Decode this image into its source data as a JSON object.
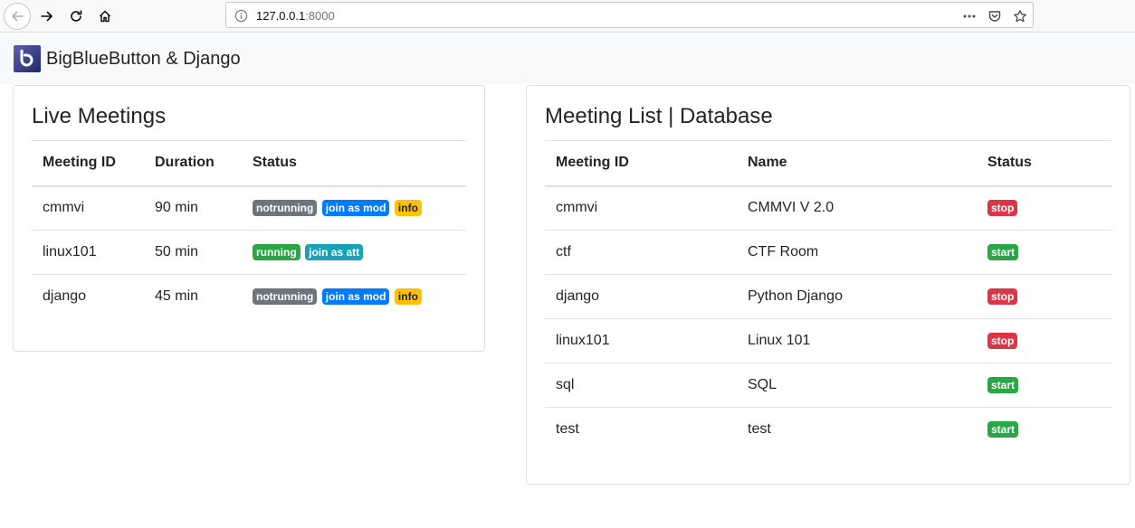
{
  "browser": {
    "url_host": "127.0.0.1",
    "url_port": ":8000"
  },
  "app": {
    "brand": "BigBlueButton & Django"
  },
  "live_meetings": {
    "title": "Live Meetings",
    "headers": {
      "meeting_id": "Meeting ID",
      "duration": "Duration",
      "status": "Status"
    },
    "rows": [
      {
        "meeting_id": "cmmvi",
        "duration": "90 min",
        "badges": [
          {
            "label": "notrunning",
            "color": "secondary"
          },
          {
            "label": "join as mod",
            "color": "primary"
          },
          {
            "label": "info",
            "color": "warning"
          }
        ]
      },
      {
        "meeting_id": "linux101",
        "duration": "50 min",
        "badges": [
          {
            "label": "running",
            "color": "success"
          },
          {
            "label": "join as att",
            "color": "info"
          }
        ]
      },
      {
        "meeting_id": "django",
        "duration": "45 min",
        "badges": [
          {
            "label": "notrunning",
            "color": "secondary"
          },
          {
            "label": "join as mod",
            "color": "primary"
          },
          {
            "label": "info",
            "color": "warning"
          }
        ]
      }
    ]
  },
  "meeting_db": {
    "title": "Meeting List | Database",
    "headers": {
      "meeting_id": "Meeting ID",
      "name": "Name",
      "status": "Status"
    },
    "rows": [
      {
        "meeting_id": "cmmvi",
        "name": "CMMVI V 2.0",
        "status": "stop",
        "color": "danger"
      },
      {
        "meeting_id": "ctf",
        "name": "CTF Room",
        "status": "start",
        "color": "success"
      },
      {
        "meeting_id": "django",
        "name": "Python Django",
        "status": "stop",
        "color": "danger"
      },
      {
        "meeting_id": "linux101",
        "name": "Linux 101",
        "status": "stop",
        "color": "danger"
      },
      {
        "meeting_id": "sql",
        "name": "SQL",
        "status": "start",
        "color": "success"
      },
      {
        "meeting_id": "test",
        "name": "test",
        "status": "start",
        "color": "success"
      }
    ]
  },
  "colors": {
    "secondary": "#6c757d",
    "primary": "#007bff",
    "warning": "#ffc107",
    "success": "#28a745",
    "info": "#17a2b8",
    "danger": "#dc3545"
  }
}
